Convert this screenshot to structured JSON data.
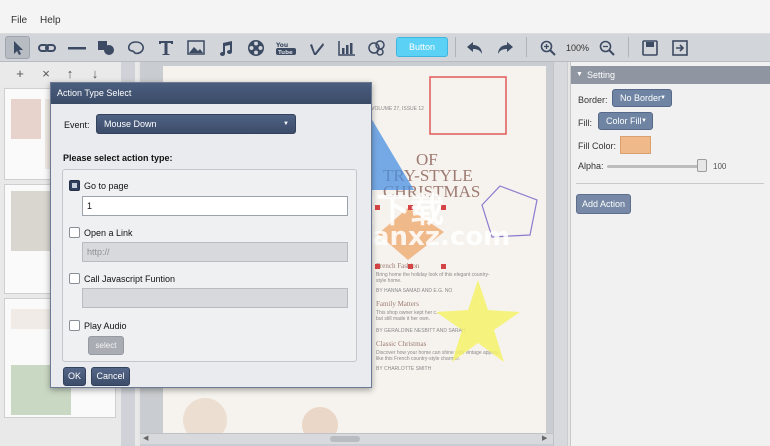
{
  "menu": {
    "file": "File",
    "help": "Help"
  },
  "toolbar": {
    "button_label": "Button",
    "zoom_level": "100%",
    "tools": [
      "pointer-icon",
      "link-icon",
      "line-icon",
      "shapes-icon",
      "palette-icon",
      "text-icon",
      "image-icon",
      "music-icon",
      "film-icon",
      "youtube-icon",
      "vimeo-icon",
      "chart-icon",
      "flash-icon",
      "button-tool",
      "undo-icon",
      "redo-icon",
      "zoom-in-icon",
      "zoom-out-icon",
      "save-icon",
      "export-icon"
    ]
  },
  "left_panel": {
    "add": "+",
    "delete": "×",
    "up": "↑",
    "down": "↓"
  },
  "page": {
    "volume": "• VOLUME 27, ISSUE 12",
    "headline_1": "OF",
    "headline_2": "TRY-STYLE",
    "headline_3": "CHRISTMAS",
    "french": "French Fashion",
    "french_body": "Bring home the holiday look of this elegant country-style home.",
    "french_by": "BY HANNA SAMAD AND E.G. NO",
    "family": "Family Matters",
    "family_body": "This shop owner kept her c... but still made it her own.",
    "family_by": "BY GERALDINE NESBITT AND SARAH",
    "classic": "Classic Christmas",
    "classic_body": "Discover how your home can shine with vintage appeal, like this French country-style charmer.",
    "classic_by": "BY CHARLOTTE SMITH"
  },
  "setting_panel": {
    "title": "Setting",
    "border_label": "Border:",
    "border_value": "No Border",
    "fill_label": "Fill:",
    "fill_value": "Color Fill",
    "fill_color_label": "Fill Color:",
    "fill_color": "#f0b98a",
    "alpha_label": "Alpha:",
    "alpha_value": "100",
    "add_action": "Add Action"
  },
  "dialog": {
    "title": "Action Type Select",
    "event_label": "Event:",
    "event_value": "Mouse Down",
    "heading": "Please select action type:",
    "go_to_page_label": "Go to page",
    "go_to_page_checked": true,
    "go_to_page_value": "1",
    "open_link_label": "Open a Link",
    "open_link_checked": false,
    "open_link_placeholder": "http://",
    "js_label": "Call Javascript Funtion",
    "js_checked": false,
    "audio_label": "Play Audio",
    "audio_checked": false,
    "select_label": "select",
    "ok": "OK",
    "cancel": "Cancel"
  },
  "watermark": {
    "cn": "安下载",
    "url": "anxz.com"
  }
}
